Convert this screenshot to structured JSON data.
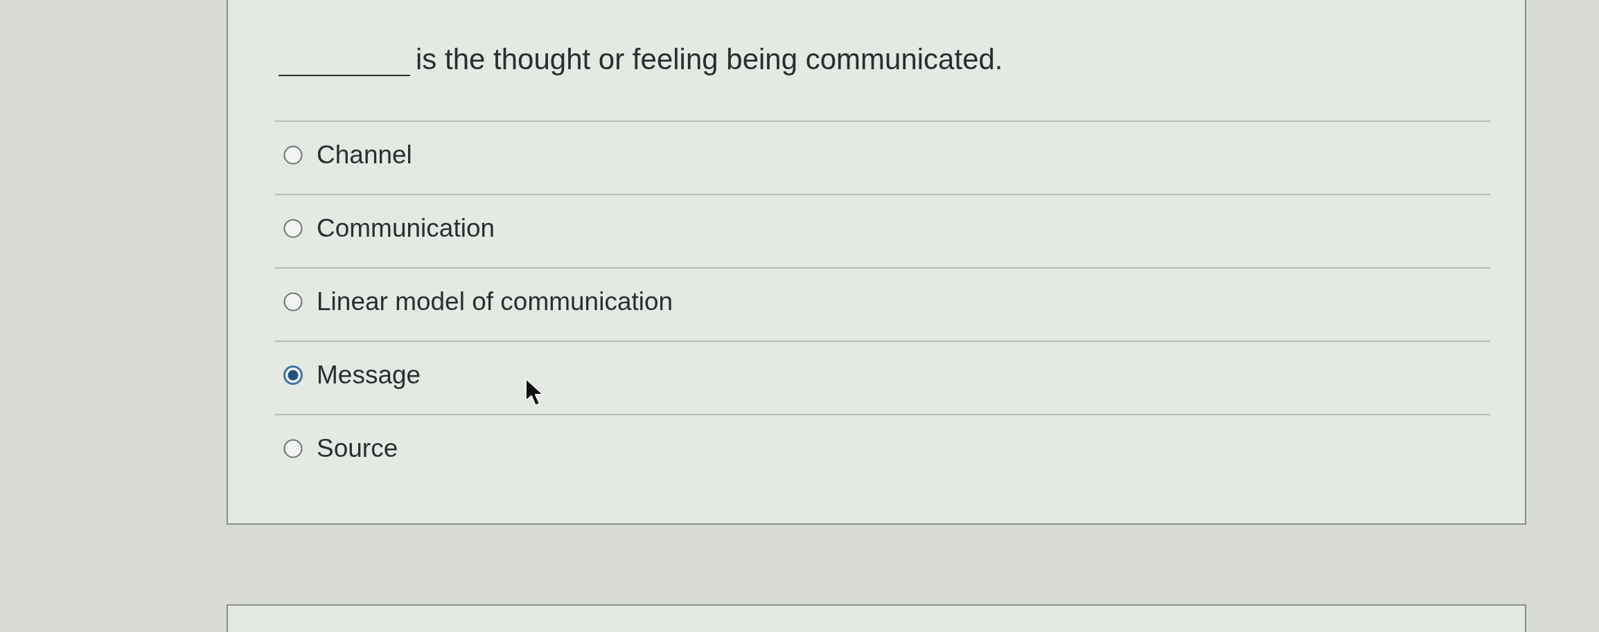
{
  "question": {
    "text": "is the thought or feeling being communicated."
  },
  "options": [
    {
      "label": "Channel",
      "selected": false
    },
    {
      "label": "Communication",
      "selected": false
    },
    {
      "label": "Linear model of communication",
      "selected": false
    },
    {
      "label": "Message",
      "selected": true
    },
    {
      "label": "Source",
      "selected": false
    }
  ]
}
